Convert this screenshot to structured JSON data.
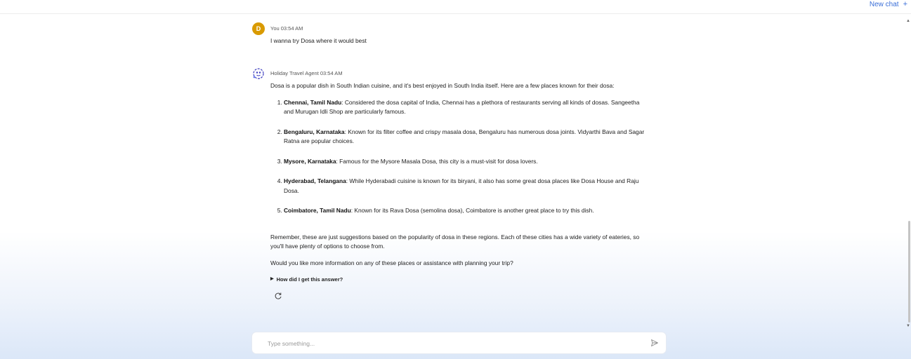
{
  "header": {
    "new_chat_label": "New chat",
    "new_chat_icon": "+"
  },
  "user_message": {
    "avatar_letter": "D",
    "meta": "You 03:54 AM",
    "text": "I wanna try Dosa where it would best"
  },
  "agent_message": {
    "meta": "Holiday Travel Agent 03:54 AM",
    "intro": "Dosa is a popular dish in South Indian cuisine, and it's best enjoyed in South India itself. Here are a few places known for their dosa:",
    "places": [
      {
        "name": "Chennai, Tamil Nadu",
        "desc": ": Considered the dosa capital of India, Chennai has a plethora of restaurants serving all kinds of dosas. Sangeetha and Murugan Idli Shop are particularly famous."
      },
      {
        "name": "Bengaluru, Karnataka",
        "desc": ": Known for its filter coffee and crispy masala dosa, Bengaluru has numerous dosa joints. Vidyarthi Bava and Sagar Ratna are popular choices."
      },
      {
        "name": "Mysore, Karnataka",
        "desc": ": Famous for the Mysore Masala Dosa, this city is a must-visit for dosa lovers."
      },
      {
        "name": "Hyderabad, Telangana",
        "desc": ": While Hyderabadi cuisine is known for its biryani, it also has some great dosa places like Dosa House and Raju Dosa."
      },
      {
        "name": "Coimbatore, Tamil Nadu",
        "desc": ": Known for its Rava Dosa (semolina dosa), Coimbatore is another great place to try this dish."
      }
    ],
    "remember": "Remember, these are just suggestions based on the popularity of dosa in these regions. Each of these cities has a wide variety of eateries, so you'll have plenty of options to choose from.",
    "question": "Would you like more information on any of these places or assistance with planning your trip?",
    "how_label": "How did I get this answer?"
  },
  "composer": {
    "placeholder": "Type something..."
  },
  "colors": {
    "accent": "#3b6fd8",
    "user_avatar": "#d99a00",
    "agent_icon": "#3d3dbf"
  }
}
